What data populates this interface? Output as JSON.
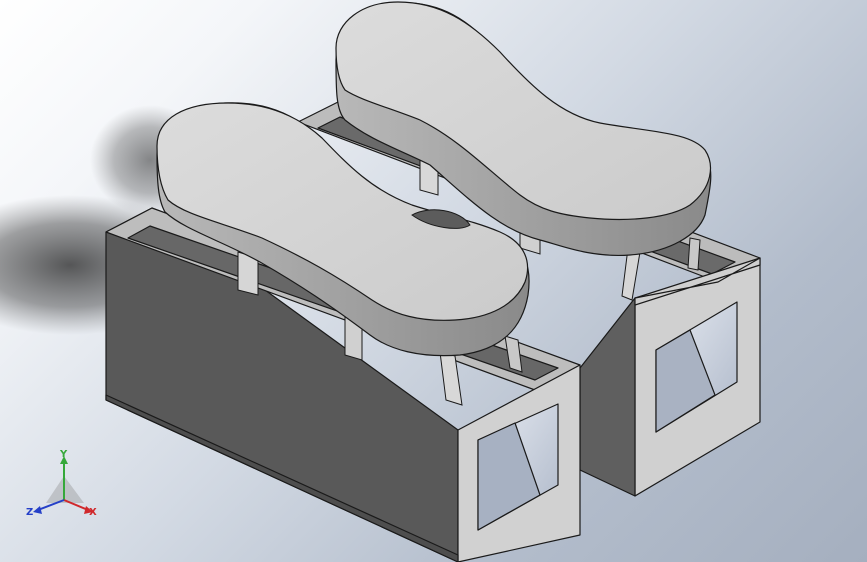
{
  "viewport": {
    "background_top": "#ffffff",
    "background_bottom": "#a5afbf"
  },
  "model": {
    "part": "twin-block-connector-with-foot-shaped-caps",
    "count": 2,
    "colors": {
      "face_light": "#cfcfcf",
      "face_top": "#bdbdbd",
      "face_front": "#9b9b9b",
      "face_dark": "#5c5c5c",
      "cap_top": "#d7d7d7",
      "cap_side": "#9e9e9e",
      "edge": "#1a1a1a",
      "window": "#c8d0e0"
    }
  },
  "triad": {
    "x_label": "X",
    "y_label": "Y",
    "z_label": "Z",
    "x_color": "#d0282b",
    "y_color": "#35a83a",
    "z_color": "#2540c8"
  }
}
